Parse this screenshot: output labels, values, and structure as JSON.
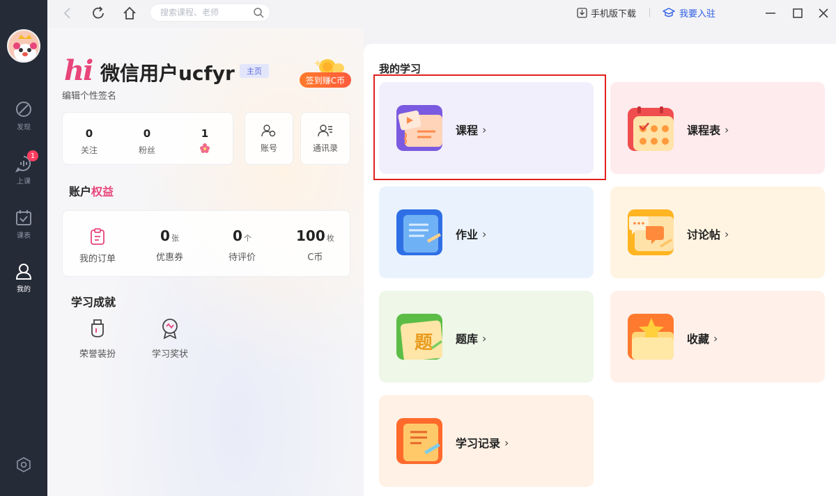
{
  "sidebar": {
    "items": [
      {
        "label": "发现",
        "icon": "compass-icon"
      },
      {
        "label": "上课",
        "icon": "chat-bubble-icon",
        "badge": "1"
      },
      {
        "label": "课表",
        "icon": "calendar-check-icon"
      },
      {
        "label": "我的",
        "icon": "user-icon",
        "active": true
      }
    ],
    "settings_icon": "hexagon-settings-icon"
  },
  "topbar": {
    "search_placeholder": "搜索课程、老师",
    "download_label": "手机版下载",
    "join_label": "我要入驻"
  },
  "profile": {
    "hi": "hi",
    "username": "微信用户ucfyr",
    "home_tag": "主页",
    "signin_label": "签到赚C币",
    "signature": "编辑个性签名",
    "stats": [
      {
        "value": "0",
        "label": "关注"
      },
      {
        "value": "0",
        "label": "粉丝"
      },
      {
        "value": "1",
        "label": "flower-icon"
      }
    ],
    "account_label": "账号",
    "contacts_label": "通讯录"
  },
  "benefits": {
    "title_prefix": "账户",
    "title_accent": "权益",
    "orders_label": "我的订单",
    "items": [
      {
        "value": "0",
        "unit": "张",
        "label": "优惠券"
      },
      {
        "value": "0",
        "unit": "个",
        "label": "待评价"
      },
      {
        "value": "100",
        "unit": "枚",
        "label": "C币"
      }
    ]
  },
  "achievements": {
    "title": "学习成就",
    "items": [
      {
        "label": "荣誉装扮",
        "icon": "trophy-cup-icon"
      },
      {
        "label": "学习奖状",
        "icon": "award-medal-icon"
      }
    ]
  },
  "study": {
    "title": "我的学习",
    "tiles": [
      {
        "label": "课程",
        "bg": "#f1effc",
        "icon": "course-play-icon"
      },
      {
        "label": "课程表",
        "bg": "#feebed",
        "icon": "timetable-calendar-icon"
      },
      {
        "label": "作业",
        "bg": "#eaf3fd",
        "icon": "homework-book-icon"
      },
      {
        "label": "讨论帖",
        "bg": "#fff4e2",
        "icon": "discussion-bubbles-icon"
      },
      {
        "label": "题库",
        "bg": "#eef7e8",
        "icon": "question-bank-icon"
      },
      {
        "label": "收藏",
        "bg": "#fff0ea",
        "icon": "favorite-folder-icon"
      },
      {
        "label": "学习记录",
        "bg": "#fff1e5",
        "icon": "study-record-icon"
      }
    ],
    "chevron": "›"
  },
  "colors": {
    "sidebar_bg": "#262b38",
    "accent_pink": "#e8457a",
    "accent_blue": "#2f5ee5",
    "highlight_red": "#e0201e"
  }
}
